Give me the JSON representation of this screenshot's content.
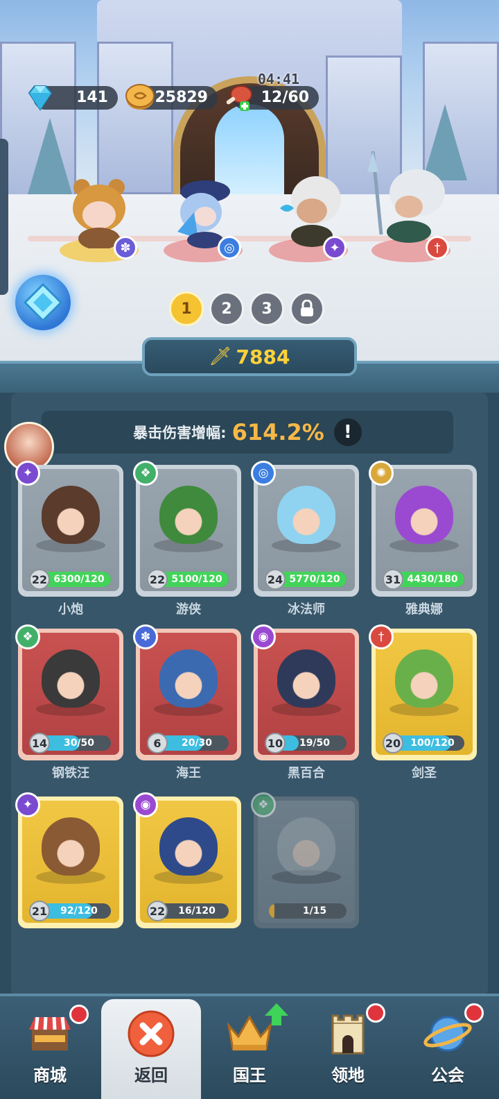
{
  "resources": {
    "gems": "141",
    "coins": "25829",
    "stamina": "12/60",
    "stamina_timer": "04:41"
  },
  "stage_heroes": [
    {
      "badge": "paw-icon",
      "ring_color": "#f2c94c"
    },
    {
      "badge": "swirl-icon",
      "ring_color": "#e86a6a"
    },
    {
      "badge": "magic-icon",
      "ring_color": "#e86a6a"
    },
    {
      "badge": "sword-icon",
      "ring_color": "#e86a6a"
    }
  ],
  "team_tabs": [
    "1",
    "2",
    "3"
  ],
  "power": "7884",
  "crit": {
    "label": "暴击伤害增幅:",
    "value": "614.2%",
    "info": "!"
  },
  "heroes": [
    {
      "name": "小炮",
      "level": "22",
      "progress_text": "6300/120",
      "progress": 1.0,
      "rarity": "grey",
      "element": "magic",
      "fill": "green"
    },
    {
      "name": "游侠",
      "level": "22",
      "progress_text": "5100/120",
      "progress": 1.0,
      "rarity": "grey",
      "element": "nature",
      "fill": "green"
    },
    {
      "name": "冰法师",
      "level": "24",
      "progress_text": "5770/120",
      "progress": 1.0,
      "rarity": "grey",
      "element": "swirl",
      "fill": "green"
    },
    {
      "name": "雅典娜",
      "level": "31",
      "progress_text": "4430/180",
      "progress": 1.0,
      "rarity": "grey",
      "element": "holy",
      "fill": "green"
    },
    {
      "name": "钢铁汪",
      "level": "14",
      "progress_text": "30/50",
      "progress": 0.6,
      "rarity": "red",
      "element": "nature",
      "fill": "blue"
    },
    {
      "name": "海王",
      "level": "6",
      "progress_text": "20/30",
      "progress": 0.67,
      "rarity": "red",
      "element": "paw",
      "fill": "blue"
    },
    {
      "name": "黑百合",
      "level": "10",
      "progress_text": "19/50",
      "progress": 0.38,
      "rarity": "red",
      "element": "eye",
      "fill": "blue"
    },
    {
      "name": "剑圣",
      "level": "20",
      "progress_text": "100/120",
      "progress": 0.83,
      "rarity": "gold",
      "element": "sword",
      "fill": "blue"
    },
    {
      "name": "",
      "level": "21",
      "progress_text": "92/120",
      "progress": 0.77,
      "rarity": "gold",
      "element": "magic",
      "fill": "blue"
    },
    {
      "name": "",
      "level": "22",
      "progress_text": "16/120",
      "progress": 0.13,
      "rarity": "gold",
      "element": "eye",
      "fill": "blue"
    },
    {
      "name": "",
      "level": "",
      "progress_text": "1/15",
      "progress": 0.07,
      "rarity": "locked",
      "element": "nature",
      "fill": "amber"
    }
  ],
  "nav": [
    {
      "label": "商城",
      "icon": "shop-icon",
      "badge": "red-dot"
    },
    {
      "label": "返回",
      "icon": "close-icon",
      "badge": ""
    },
    {
      "label": "国王",
      "icon": "crown-icon",
      "badge": "up-arrow"
    },
    {
      "label": "领地",
      "icon": "castle-icon",
      "badge": "red-dot"
    },
    {
      "label": "公会",
      "icon": "planet-icon",
      "badge": "red-dot"
    }
  ],
  "colors": {
    "panel": "#2f4b5e",
    "accent_gold": "#ffd23a",
    "crit_value": "#f7b847",
    "notification": "#e0343c"
  }
}
